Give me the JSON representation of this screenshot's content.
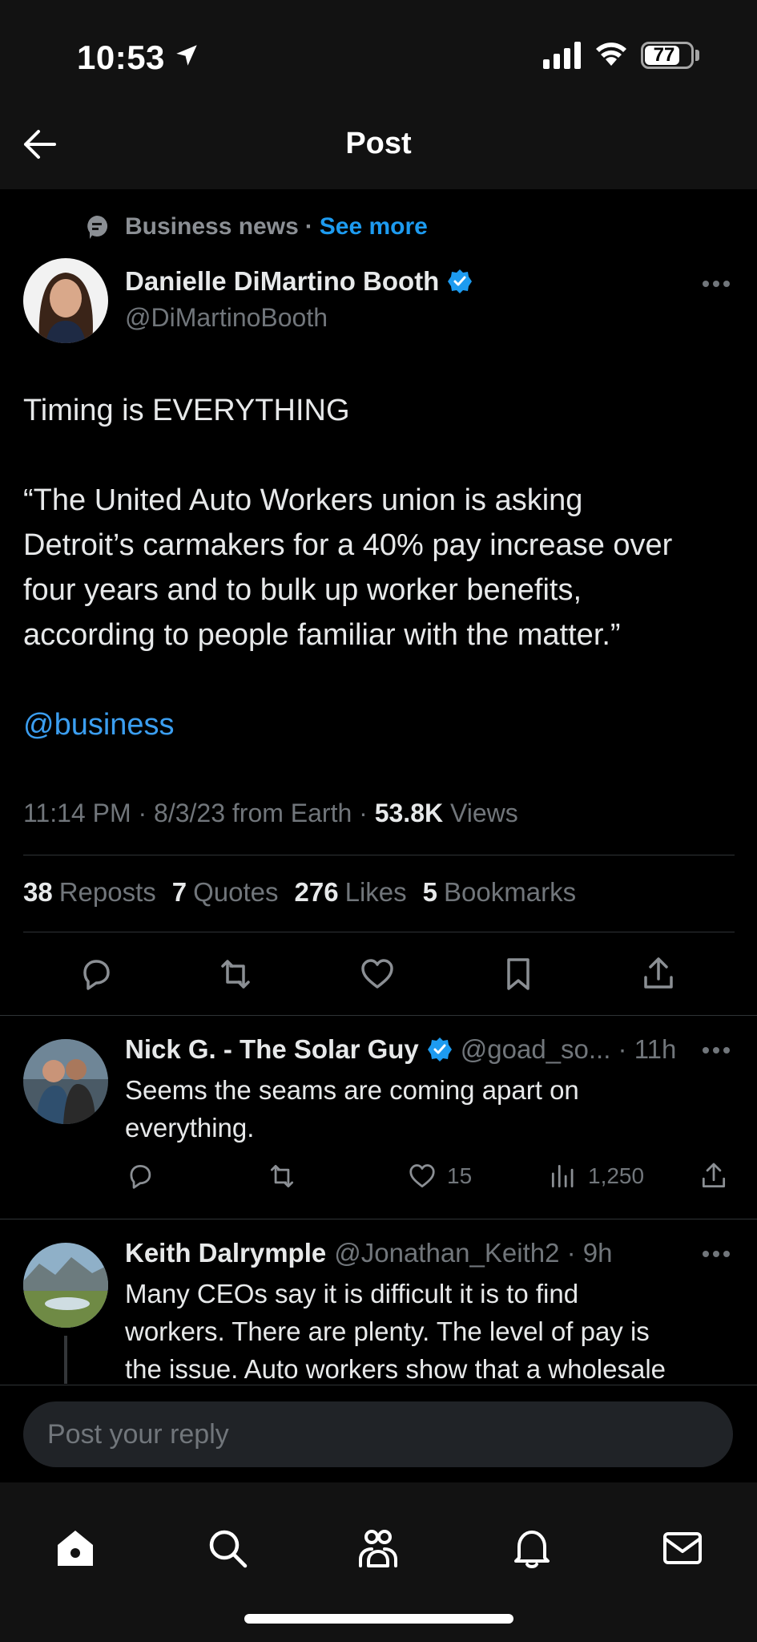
{
  "status": {
    "time": "10:53",
    "battery": "77",
    "battery_level": 0.77
  },
  "header": {
    "title": "Post"
  },
  "context": {
    "topic": "Business news",
    "separator": "·",
    "see_more": "See more"
  },
  "author": {
    "name": "Danielle DiMartino Booth",
    "handle": "@DiMartinoBooth"
  },
  "tweet": {
    "line1": "Timing is EVERYTHING",
    "quote_lines": [
      "“The United Auto Workers union is asking",
      "Detroit’s carmakers for a 40% pay increase over",
      "four years and to bulk up worker benefits,",
      "according to people familiar with the matter.”"
    ],
    "mention": "@business"
  },
  "meta": {
    "time": "11:14 PM",
    "sep": "·",
    "date_source": "8/3/23 from Earth",
    "views_count": "53.8K",
    "views_label": "Views"
  },
  "stats": {
    "reposts_count": "38",
    "reposts_label": "Reposts",
    "quotes_count": "7",
    "quotes_label": "Quotes",
    "likes_count": "276",
    "likes_label": "Likes",
    "bookmarks_count": "5",
    "bookmarks_label": "Bookmarks"
  },
  "replies": [
    {
      "name": "Nick G. - The Solar Guy",
      "handle_time": "@goad_so... · 11h",
      "lines": [
        "Seems the seams are coming apart on",
        "everything."
      ],
      "likes": "15",
      "views": "1,250"
    },
    {
      "name": "Keith Dalrymple",
      "handle_time": "@Jonathan_Keith2 · 9h",
      "lines": [
        "Many CEOs  say it is difficult it is to find",
        "workers.   There are plenty.  The level of pay is",
        "the issue.   Auto workers show that a wholesale"
      ]
    }
  ],
  "composer": {
    "placeholder": "Post your reply"
  },
  "colors": {
    "accent": "#1d9bf0",
    "background": "#000000",
    "muted": "#71767b"
  }
}
